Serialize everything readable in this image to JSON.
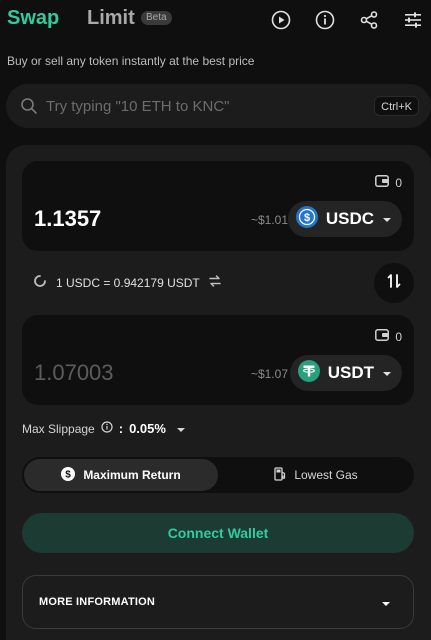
{
  "header": {
    "tab_swap": "Swap",
    "tab_limit": "Limit",
    "beta_badge": "Beta",
    "icons": [
      "play-icon",
      "info-icon",
      "share-icon",
      "settings-sliders-icon"
    ]
  },
  "subtitle": "Buy or sell any token instantly at the best price",
  "search": {
    "placeholder": "Try typing \"10 ETH to KNC\"",
    "shortcut": "Ctrl+K"
  },
  "from": {
    "balance": "0",
    "amount": "1.1357",
    "usd_value": "~$1.01",
    "token": "USDC",
    "token_color": "#2775ca"
  },
  "rate": {
    "text": "1 USDC = 0.942179 USDT"
  },
  "to": {
    "balance": "0",
    "amount": "1.07003",
    "usd_value": "~$1.07",
    "token": "USDT",
    "token_color": "#26a17b"
  },
  "slippage": {
    "label": "Max Slippage",
    "separator": ":",
    "value": "0.05%"
  },
  "route": {
    "max_return": "Maximum Return",
    "lowest_gas": "Lowest Gas",
    "selected": "Maximum Return"
  },
  "connect_label": "Connect Wallet",
  "more_info_label": "MORE INFORMATION",
  "colors": {
    "accent": "#31cb9e",
    "background": "#0f0f0f",
    "card": "#1c1c1c"
  }
}
